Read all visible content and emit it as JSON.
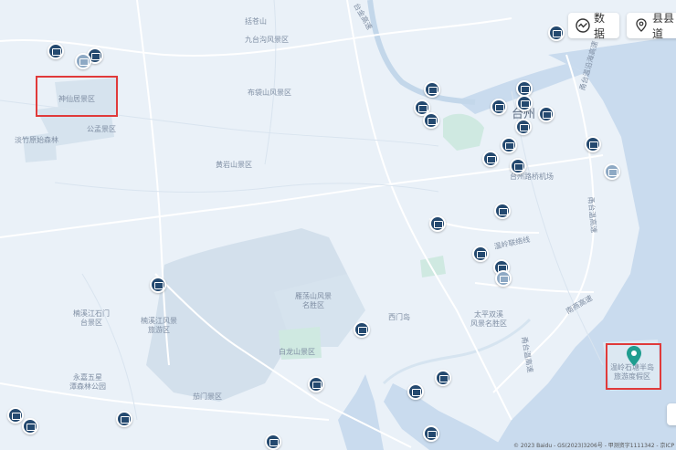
{
  "toolbar": {
    "data_label": "数据",
    "county_label": "县县道"
  },
  "labels": {
    "kuocang_mt": "括苍山",
    "jiuao_scenic": "九台沟风景区",
    "shenxianju": "神仙居景区",
    "gongyu": "公孟景区",
    "danzhu": "淡竹原始森林",
    "buddha": "布袋山风景区",
    "huangyan": "黄岩山景区",
    "taizhou": "台州",
    "airport": "台州路桥机场",
    "highway1": "甬台温沿海高速",
    "coastline": "温岭联络线",
    "south_high": "甬台温高速",
    "nanyan_high": "南燕高速",
    "zhejiang_high": "甬台温高速",
    "nanxi_shimen": "楠溪江石门\n台景区",
    "nanxi_park": "楠溪江风景\n旅游区",
    "yandang": "雁荡山风景\n名胜区",
    "ximen": "西门岛",
    "taipingyang": "太平双溪\n风景名胜区",
    "baiyang": "白龙山景区",
    "yongjia": "永嘉五星\n潭森林公园",
    "qiaomen": "茄门景区",
    "wenling_peninsula": "温岭石塘半岛\n旅游度假区",
    "left_top_road": "台金高速"
  },
  "copyright": "© 2023 Baidu - GS(2023)3206号 - 甲测资字1111342 - 京ICP"
}
